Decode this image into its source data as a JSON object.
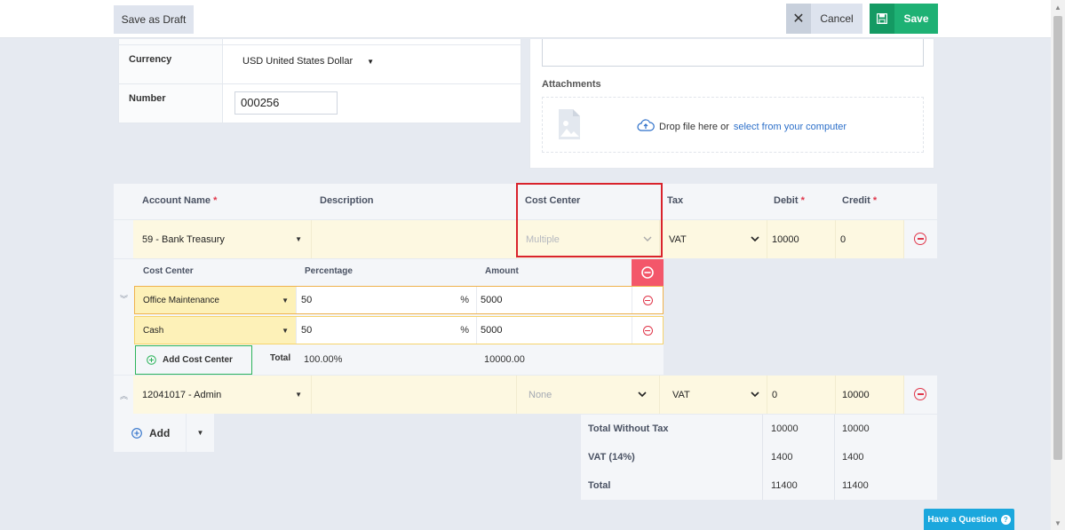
{
  "topbar": {
    "save_draft": "Save as Draft",
    "cancel": "Cancel",
    "save": "Save"
  },
  "form": {
    "currency_label": "Currency",
    "currency_value": "USD United States Dollar",
    "number_label": "Number",
    "number_value": "000256"
  },
  "attachments": {
    "label": "Attachments",
    "drop_text": "Drop file here or",
    "select_link": "select from your computer"
  },
  "table": {
    "headers": {
      "account": "Account Name",
      "description": "Description",
      "cost_center": "Cost Center",
      "tax": "Tax",
      "debit": "Debit",
      "credit": "Credit",
      "required_mark": "*"
    },
    "rows": [
      {
        "account": "59 - Bank Treasury",
        "description": "",
        "cost_center": "Multiple",
        "tax": "VAT",
        "debit": "10000",
        "credit": "0"
      },
      {
        "account": "12041017 - Admin",
        "description": "",
        "cost_center": "None",
        "tax": "VAT",
        "debit": "0",
        "credit": "10000"
      }
    ]
  },
  "cost_centers": {
    "headers": {
      "cost_center": "Cost Center",
      "percentage": "Percentage",
      "amount": "Amount"
    },
    "rows": [
      {
        "cost_center": "Office Maintenance",
        "percentage": "50",
        "unit": "%",
        "amount": "5000"
      },
      {
        "cost_center": "Cash",
        "percentage": "50",
        "unit": "%",
        "amount": "5000"
      }
    ],
    "add_label": "Add Cost Center",
    "total_label": "Total",
    "total_percentage": "100.00%",
    "total_amount": "10000.00"
  },
  "add_button": "Add",
  "totals": [
    {
      "label": "Total Without Tax",
      "debit": "10000",
      "credit": "10000"
    },
    {
      "label": "VAT (14%)",
      "debit": "1400",
      "credit": "1400"
    },
    {
      "label": "Total",
      "debit": "11400",
      "credit": "11400"
    }
  ],
  "help": {
    "label": "Have a Question",
    "q": "?"
  },
  "colors": {
    "accent_green": "#1eb174",
    "danger_red": "#e0364a",
    "highlight_border": "#d9232c",
    "link_blue": "#2c6fc9",
    "help_blue": "#1ba7dd",
    "row_yellow": "#fdf8e1"
  }
}
